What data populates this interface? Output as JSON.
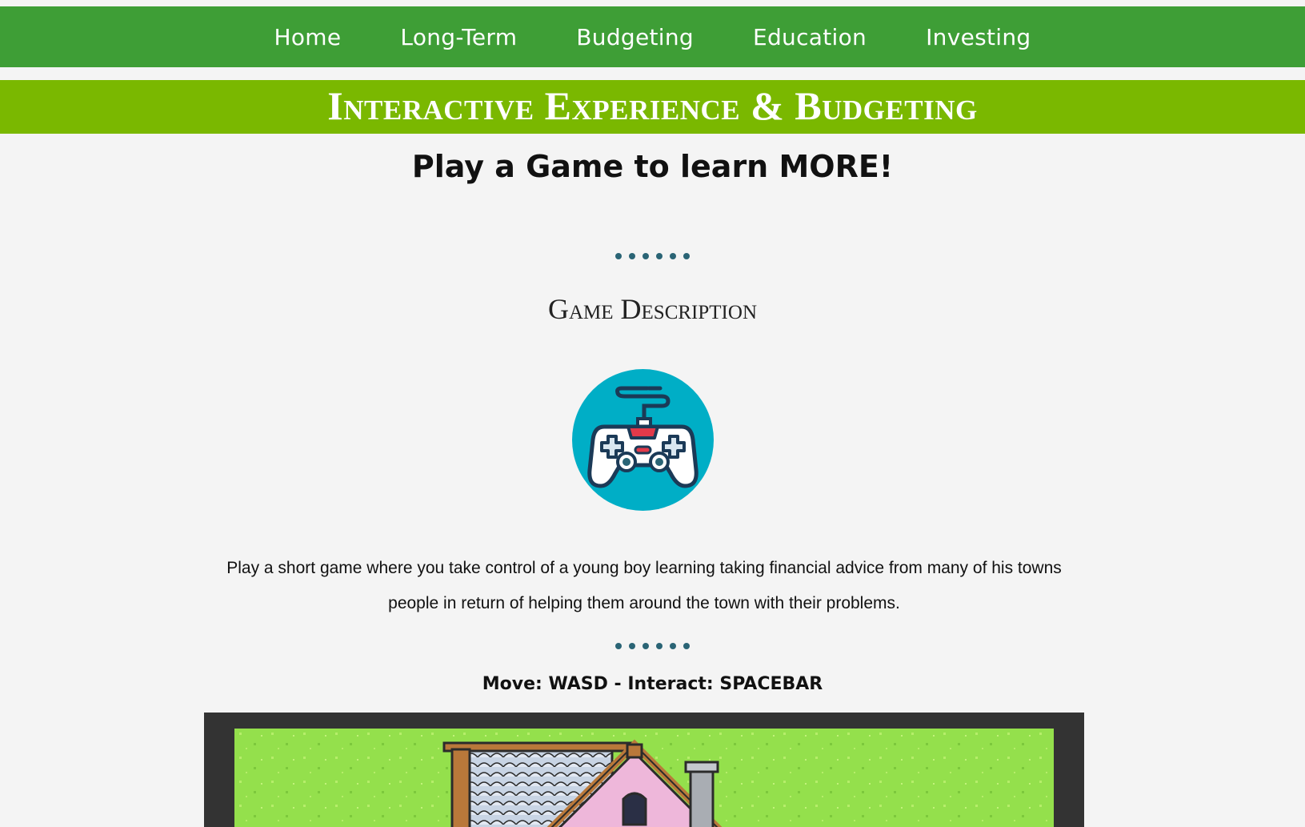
{
  "nav": {
    "items": [
      {
        "label": "Home"
      },
      {
        "label": "Long-Term"
      },
      {
        "label": "Budgeting"
      },
      {
        "label": "Education"
      },
      {
        "label": "Investing"
      }
    ]
  },
  "banner": {
    "title": "Interactive Experience & Budgeting"
  },
  "main": {
    "heading": "Play a Game to learn MORE!",
    "section_title": "Game Description",
    "description": "Play a short game where you take control of a young boy learning taking financial advice from many of his towns people in return of helping them around the town with their problems.",
    "controls": "Move: WASD - Interact: SPACEBAR"
  },
  "colors": {
    "nav_bg": "#3e9e36",
    "banner_bg": "#7ab800",
    "icon_circle": "#00aec6",
    "dot": "#2a6475",
    "game_frame": "#333333",
    "grass": "#94e04c"
  },
  "icons": {
    "game_icon": "gamepad-icon"
  }
}
